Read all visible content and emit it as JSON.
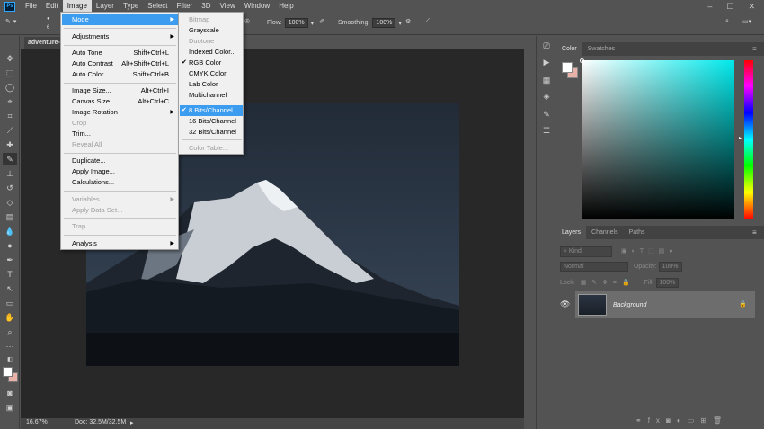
{
  "menubar": {
    "logo": "Ps",
    "items": [
      "File",
      "Edit",
      "Image",
      "Layer",
      "Type",
      "Select",
      "Filter",
      "3D",
      "View",
      "Window",
      "Help"
    ],
    "active": "Image",
    "window_controls": [
      "–",
      "☐",
      "✕"
    ]
  },
  "options": {
    "brush_size": "6",
    "flow_label": "Flow:",
    "flow_value": "100%",
    "smoothing_label": "Smoothing:",
    "smoothing_value": "100%"
  },
  "document": {
    "tab_title": "adventure-",
    "zoom": "16.67%",
    "doc_size": "Doc: 32.5M/32.5M"
  },
  "image_menu": {
    "mode": "Mode",
    "adjustments": "Adjustments",
    "auto_tone": "Auto Tone",
    "auto_tone_sc": "Shift+Ctrl+L",
    "auto_contrast": "Auto Contrast",
    "auto_contrast_sc": "Alt+Shift+Ctrl+L",
    "auto_color": "Auto Color",
    "auto_color_sc": "Shift+Ctrl+B",
    "image_size": "Image Size...",
    "image_size_sc": "Alt+Ctrl+I",
    "canvas_size": "Canvas Size...",
    "canvas_size_sc": "Alt+Ctrl+C",
    "image_rotation": "Image Rotation",
    "crop": "Crop",
    "trim": "Trim...",
    "reveal_all": "Reveal All",
    "duplicate": "Duplicate...",
    "apply_image": "Apply Image...",
    "calculations": "Calculations...",
    "variables": "Variables",
    "apply_data_set": "Apply Data Set...",
    "trap": "Trap...",
    "analysis": "Analysis"
  },
  "mode_submenu": {
    "bitmap": "Bitmap",
    "grayscale": "Grayscale",
    "duotone": "Duotone",
    "indexed_color": "Indexed Color...",
    "rgb_color": "RGB Color",
    "cmyk_color": "CMYK Color",
    "lab_color": "Lab Color",
    "multichannel": "Multichannel",
    "bits8": "8 Bits/Channel",
    "bits16": "16 Bits/Channel",
    "bits32": "32 Bits/Channel",
    "color_table": "Color Table..."
  },
  "panels": {
    "color_tab": "Color",
    "swatches_tab": "Swatches",
    "layers_tab": "Layers",
    "channels_tab": "Channels",
    "paths_tab": "Paths",
    "kind": "Kind",
    "blend_mode": "Normal",
    "opacity_label": "Opacity:",
    "opacity_value": "100%",
    "lock_label": "Lock:",
    "fill_label": "Fill:",
    "fill_value": "100%",
    "layer_name": "Background"
  },
  "colors": {
    "foreground": "#ffffff",
    "background": "#e9b2a9",
    "menu_highlight": "#3b9cf0"
  }
}
